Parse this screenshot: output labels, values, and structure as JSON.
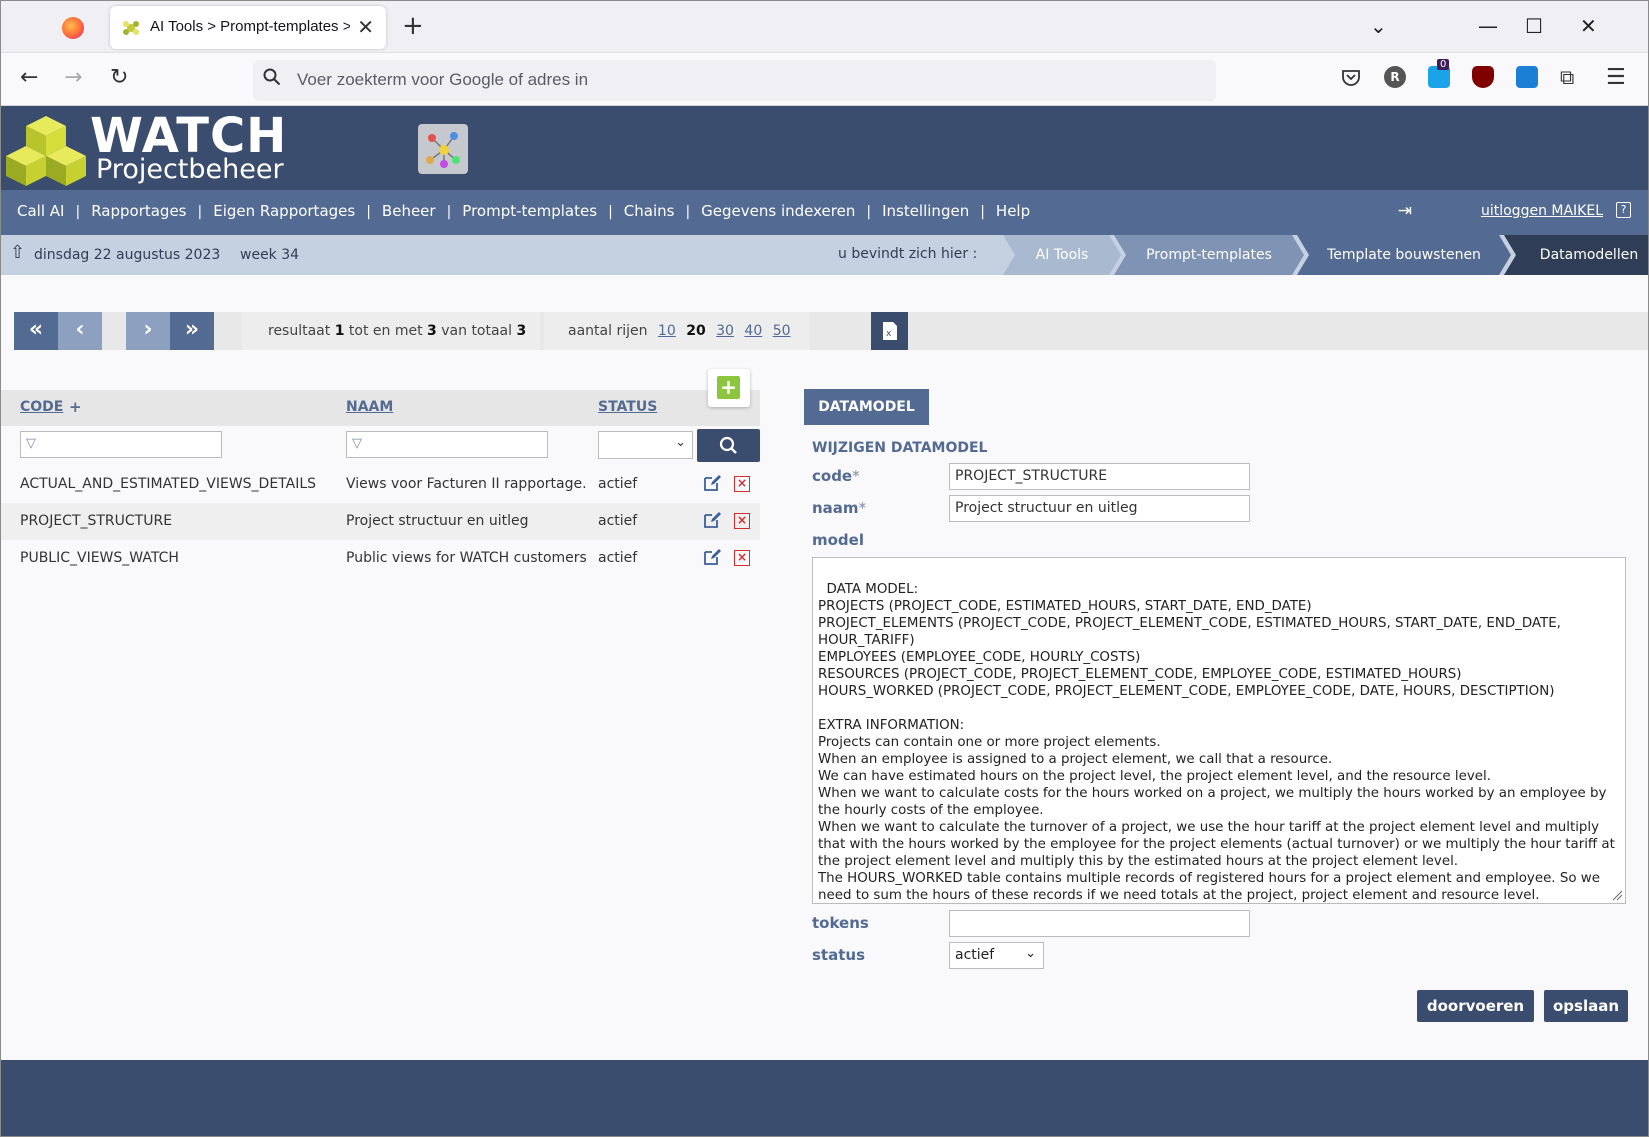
{
  "browser": {
    "tab_title": "AI Tools > Prompt-templates >",
    "url_placeholder": "Voer zoekterm voor Google of adres in",
    "extension_badge": "0"
  },
  "app": {
    "logo_title": "WATCH",
    "logo_subtitle": "Projectbeheer",
    "menu": [
      "Call AI",
      "Rapportages",
      "Eigen Rapportages",
      "Beheer",
      "Prompt-templates",
      "Chains",
      "Gegevens indexeren",
      "Instellingen",
      "Help"
    ],
    "menu_sep": "|",
    "logout_label": "uitloggen MAIKEL",
    "help_glyph": "?"
  },
  "crumbbar": {
    "date": "dinsdag 22 augustus 2023",
    "week": "week 34",
    "you_are_here": "u bevindt zich hier :",
    "crumbs": [
      "AI Tools",
      "Prompt-templates",
      "Template bouwstenen",
      "Datamodellen"
    ]
  },
  "pager": {
    "result_prefix": "resultaat",
    "result_from": "1",
    "result_mid": "tot en met",
    "result_to": "3",
    "result_total_label": "van totaal",
    "result_total": "3",
    "rows_label": "aantal rijen",
    "row_sizes": [
      "10",
      "20",
      "30",
      "40",
      "50"
    ],
    "current_row_size": "20"
  },
  "list": {
    "columns": {
      "code": "CODE",
      "sort_marker": "+",
      "naam": "NAAM",
      "status": "STATUS"
    },
    "add_glyph": "+",
    "rows": [
      {
        "code": "ACTUAL_AND_ESTIMATED_VIEWS_DETAILS",
        "naam": "Views voor Facturen II rapportage.",
        "status": "actief"
      },
      {
        "code": "PROJECT_STRUCTURE",
        "naam": "Project structuur en uitleg",
        "status": "actief"
      },
      {
        "code": "PUBLIC_VIEWS_WATCH",
        "naam": "Public views for WATCH customers",
        "status": "actief"
      }
    ]
  },
  "detail": {
    "tab_label": "DATAMODEL",
    "heading": "WIJZIGEN DATAMODEL",
    "code_label": "code",
    "naam_label": "naam",
    "required_marker": "*",
    "model_label": "model",
    "tokens_label": "tokens",
    "status_label": "status",
    "code_value": "PROJECT_STRUCTURE",
    "naam_value": "Project structuur en uitleg",
    "tokens_value": "",
    "status_value": "actief",
    "model_value": "DATA MODEL:\nPROJECTS (PROJECT_CODE, ESTIMATED_HOURS, START_DATE, END_DATE)\nPROJECT_ELEMENTS (PROJECT_CODE, PROJECT_ELEMENT_CODE, ESTIMATED_HOURS, START_DATE, END_DATE, HOUR_TARIFF)\nEMPLOYEES (EMPLOYEE_CODE, HOURLY_COSTS)\nRESOURCES (PROJECT_CODE, PROJECT_ELEMENT_CODE, EMPLOYEE_CODE, ESTIMATED_HOURS)\nHOURS_WORKED (PROJECT_CODE, PROJECT_ELEMENT_CODE, EMPLOYEE_CODE, DATE, HOURS, DESCTIPTION)\n\nEXTRA INFORMATION:\nProjects can contain one or more project elements.\nWhen an employee is assigned to a project element, we call that a resource.\nWe can have estimated hours on the project level, the project element level, and the resource level.\nWhen we want to calculate costs for the hours worked on a project, we multiply the hours worked by an employee by the hourly costs of the employee.\nWhen we want to calculate the turnover of a project, we use the hour tariff at the project element level and multiply that with the hours worked by the employee for the project elements (actual turnover) or we multiply the hour tariff at the project element level and multiply this by the estimated hours at the project element level.\nThe HOURS_WORKED table contains multiple records of registered hours for a project element and employee. So we need to sum the hours of these records if we need totals at the project, project element and resource level.",
    "button_proceed": "doorvoeren",
    "button_save": "opslaan"
  },
  "colors": {
    "header_bg": "#3b4d6e",
    "menu_bg": "#536a92",
    "crumb_bg": "#c5d1e0",
    "add_green": "#8cc63f",
    "delete_red": "#d12b2b"
  },
  "icons": [
    "firefox-icon",
    "tab-favicon-icon",
    "close-icon",
    "plus-icon",
    "chevron-down-icon",
    "minimize-icon",
    "maximize-icon",
    "back-arrow-icon",
    "forward-arrow-icon",
    "reload-icon",
    "search-icon",
    "pocket-icon",
    "home-icon",
    "logout-icon",
    "help-icon",
    "first-page-icon",
    "prev-page-icon",
    "next-page-icon",
    "last-page-icon",
    "excel-export-icon",
    "filter-icon",
    "edit-icon",
    "delete-icon"
  ]
}
